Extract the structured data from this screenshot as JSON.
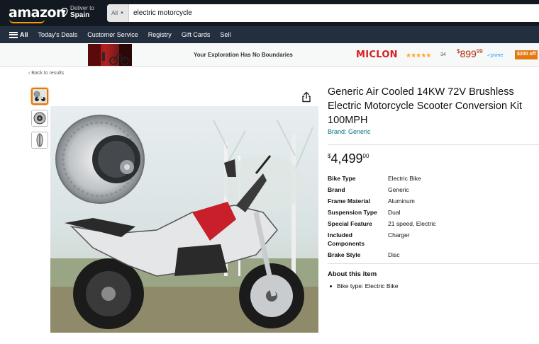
{
  "nav": {
    "logo": "amazon",
    "deliver_line1": "Deliver to",
    "deliver_line2": "Spain",
    "search_category": "All",
    "search_value": "electric motorcycle",
    "links": [
      "All",
      "Today's Deals",
      "Customer Service",
      "Registry",
      "Gift Cards",
      "Sell"
    ]
  },
  "ad": {
    "tagline": "Your Exploration Has No Boundaries",
    "brand": "MICLON",
    "stars": "★★★★★",
    "rating_count": "34",
    "price_symbol": "$",
    "price_whole": "899",
    "price_fraction": "99",
    "prime": "✓prime",
    "coupon": "$200 off"
  },
  "breadcrumb": "‹ Back to results",
  "product": {
    "title": "Generic Air Cooled 14KW 72V Brushless Electric Motorcycle Scooter Conversion Kit 100MPH",
    "brand_link": "Brand: Generic",
    "price_symbol": "$",
    "price_whole": "4,499",
    "price_fraction": "00",
    "specs": [
      {
        "label": "Bike Type",
        "value": "Electric Bike"
      },
      {
        "label": "Brand",
        "value": "Generic"
      },
      {
        "label": "Frame Material",
        "value": "Aluminum"
      },
      {
        "label": "Suspension Type",
        "value": "Dual"
      },
      {
        "label": "Special Feature",
        "value": "21 speed, Electric"
      },
      {
        "label": "Included Components",
        "value": "Charger"
      },
      {
        "label": "Brake Style",
        "value": "Disc"
      }
    ],
    "about_heading": "About this item",
    "about_bullets": [
      "Bike type: Electric Bike"
    ]
  },
  "colors": {
    "nav_bg": "#131921",
    "subnav_bg": "#232f3e",
    "accent": "#ff9900",
    "link": "#007185",
    "deal_price": "#b12704",
    "brand_red": "#d71f20"
  },
  "icons": [
    "location-pin-icon",
    "hamburger-icon",
    "share-icon",
    "star-icon"
  ]
}
